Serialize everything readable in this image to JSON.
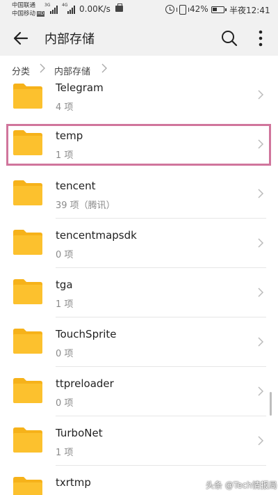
{
  "status_bar": {
    "carrier_1": "中国联通",
    "carrier_2": "中国移动",
    "hd_badge": "HD",
    "net_3g": "3G",
    "net_4g": "4G",
    "net_speed": "0.00K/s",
    "battery_percent": "42%",
    "battery_level": 0.42,
    "time": "半夜12:41"
  },
  "app_bar": {
    "back_icon": "arrow-left-icon",
    "title": "内部存储",
    "search_icon": "search-icon",
    "more_icon": "more-vertical-icon"
  },
  "breadcrumb": {
    "items": [
      "分类",
      "内部存储"
    ]
  },
  "colors": {
    "folder": "#fbbf24",
    "folder_tab": "#f6b21a",
    "highlight": "#d0759c",
    "bar_bg": "#f1f1f1"
  },
  "folders": [
    {
      "name": "Telegram",
      "meta": "4 项"
    },
    {
      "name": "temp",
      "meta": "1 项"
    },
    {
      "name": "tencent",
      "meta": "39 项（腾讯）"
    },
    {
      "name": "tencentmapsdk",
      "meta": "0 项"
    },
    {
      "name": "tga",
      "meta": "1 项"
    },
    {
      "name": "TouchSprite",
      "meta": "0 项"
    },
    {
      "name": "ttpreloader",
      "meta": "0 项"
    },
    {
      "name": "TurboNet",
      "meta": "1 项"
    },
    {
      "name": "txrtmp",
      "meta": ""
    }
  ],
  "watermark": "头条 @Tech情报局"
}
